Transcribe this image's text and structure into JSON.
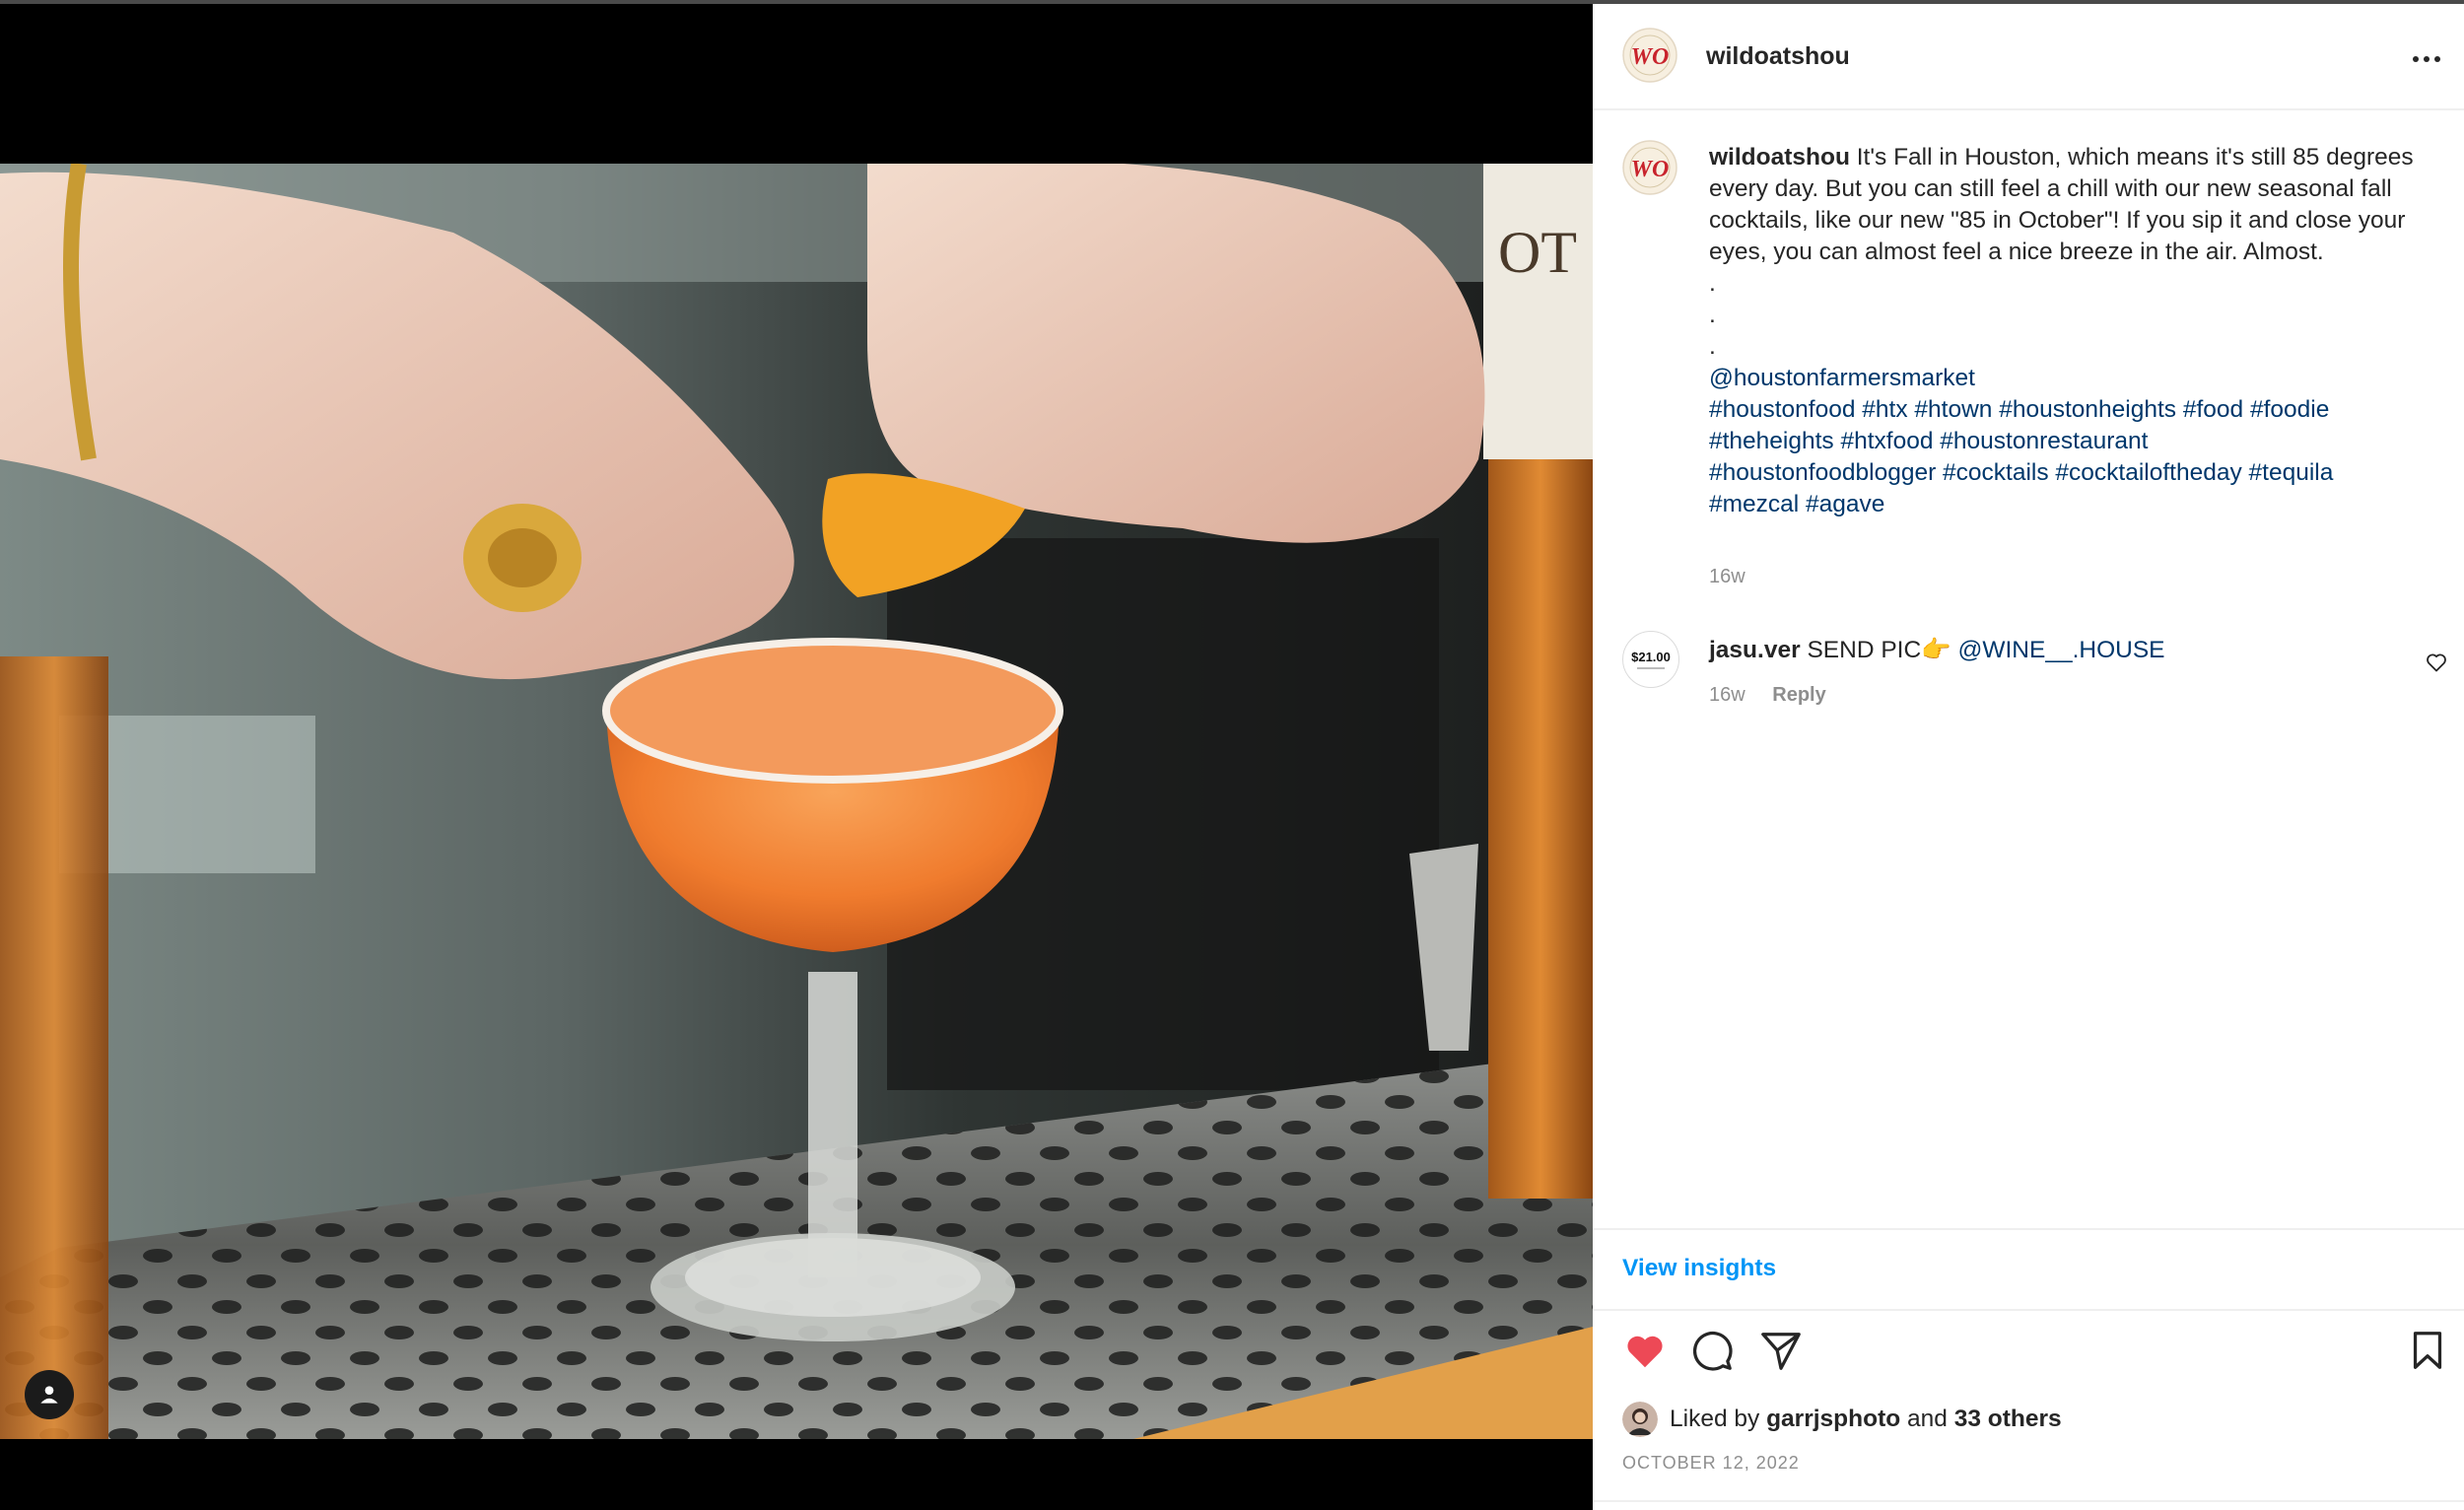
{
  "header": {
    "username": "wildoatshou",
    "avatar_logo_text": "WO"
  },
  "caption": {
    "username": "wildoatshou",
    "text": "It's Fall in Houston, which means it's still 85 degrees every day. But you can still feel a chill with our new seasonal fall cocktails, like our new \"85 in October\"! If you sip it and close your eyes, you can almost feel a nice breeze in the air. Almost.",
    "dot_lines": [
      ".",
      ".",
      "."
    ],
    "mention": "@houstonfarmersmarket",
    "hashtag_lines": [
      "#houstonfood #htx #htown #houstonheights #food #foodie",
      "#theheights #htxfood #houstonrestaurant",
      "#houstonfoodblogger #cocktails #cocktailoftheday #tequila",
      "#mezcal #agave"
    ],
    "time": "16w"
  },
  "comment": {
    "avatar_text": "$21.00",
    "username": "jasu.ver",
    "text": "SEND PIC👉",
    "mention": "@WINE__.HOUSE",
    "time": "16w",
    "reply_label": "Reply"
  },
  "insights": {
    "label": "View insights"
  },
  "actions": {
    "like": "heart-filled-icon",
    "comment": "comment-icon",
    "share": "share-icon",
    "save": "bookmark-icon"
  },
  "likes": {
    "prefix": "Liked by",
    "user": "garrjsphoto",
    "conj": "and",
    "others": "33 others"
  },
  "post_date": "OCTOBER 12, 2022",
  "colors": {
    "link_blue": "#00376b",
    "insights_blue": "#0095f6",
    "like_red": "#ed4956",
    "muted_gray": "#8e8e8e"
  }
}
